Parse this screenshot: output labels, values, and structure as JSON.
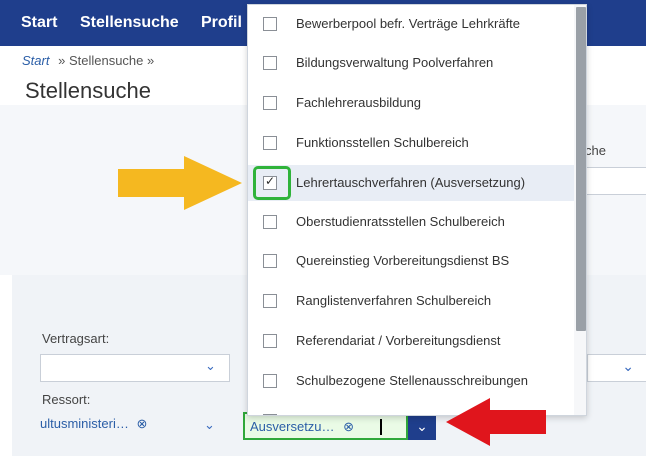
{
  "nav": {
    "items": [
      {
        "label": "Start"
      },
      {
        "label": "Stellensuche"
      },
      {
        "label": "Profil"
      }
    ]
  },
  "breadcrumb": {
    "start": "Start",
    "sep1": "»",
    "current": "Stellensuche",
    "sep2": "»"
  },
  "page": {
    "title": "Stellensuche",
    "right_label_fragment": "che"
  },
  "form": {
    "vertragsart_label": "Vertragsart:",
    "ressort_label": "Ressort:",
    "ressort_token": "ultusministeri…",
    "ressort_remove_symbol": "⊗",
    "filter_token": "Ausversetzu…",
    "filter_remove_symbol": "⊗",
    "chevron": "⌄"
  },
  "dropdown": {
    "options": [
      {
        "label": "Bewerberpool befr. Verträge Lehrkräfte",
        "checked": false
      },
      {
        "label": "Bildungsverwaltung Poolverfahren",
        "checked": false
      },
      {
        "label": "Fachlehrerausbildung",
        "checked": false
      },
      {
        "label": "Funktionsstellen Schulbereich",
        "checked": false
      },
      {
        "label": "Lehrertauschverfahren (Ausversetzung)",
        "checked": true
      },
      {
        "label": "Oberstudienratsstellen Schulbereich",
        "checked": false
      },
      {
        "label": "Quereinstieg Vorbereitungsdienst BS",
        "checked": false
      },
      {
        "label": "Ranglistenverfahren Schulbereich",
        "checked": false
      },
      {
        "label": "Referendariat / Vorbereitungsdienst",
        "checked": false
      },
      {
        "label": "Schulbezogene Stellenausschreibungen",
        "checked": false
      }
    ],
    "check_symbol": "✓"
  },
  "colors": {
    "nav_bg": "#1f3e8c",
    "highlight_green": "#2fb33a",
    "annotation_yellow": "#f5b820",
    "annotation_red": "#e0151c"
  }
}
